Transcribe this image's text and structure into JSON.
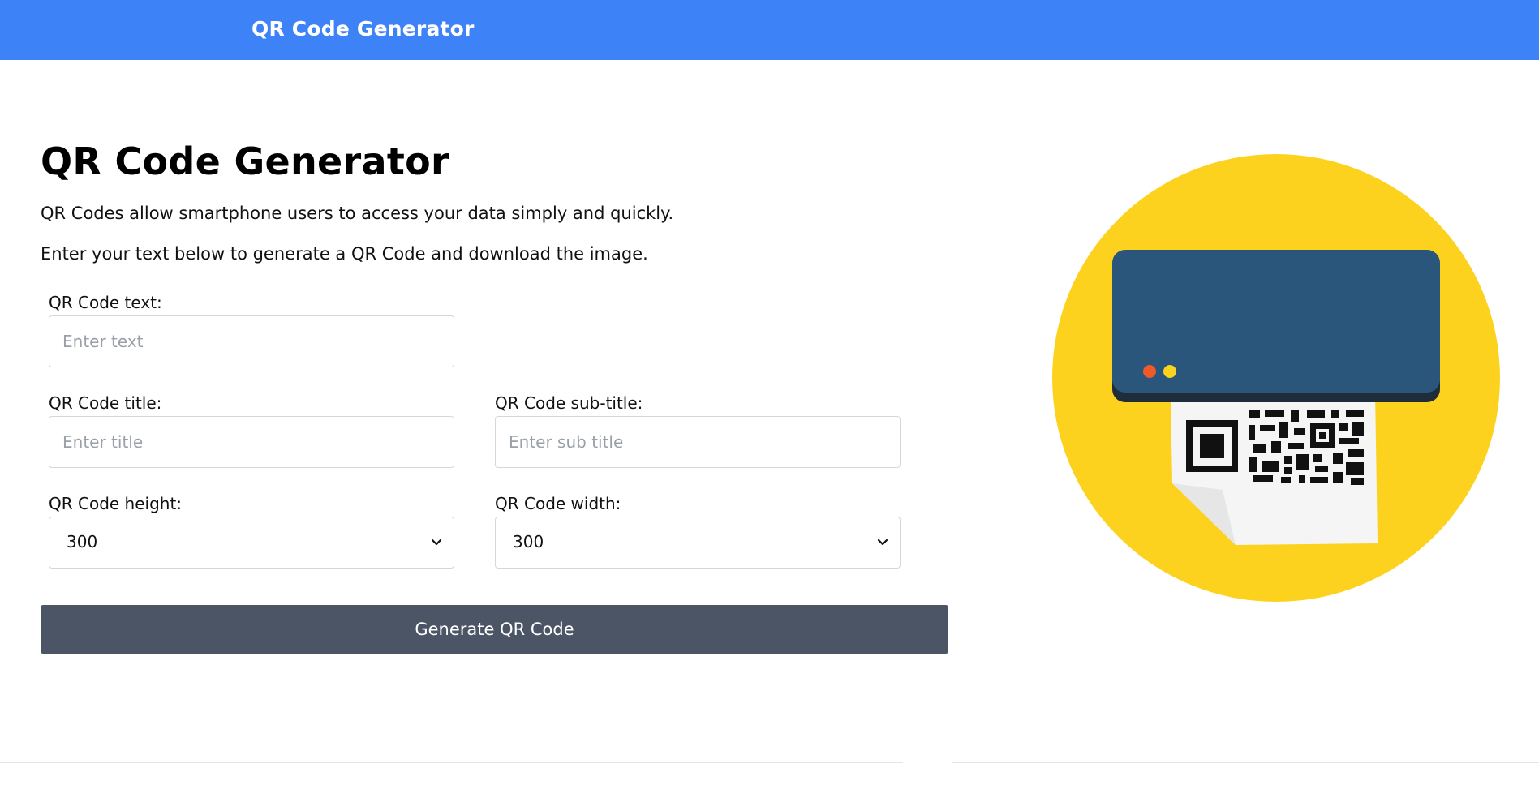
{
  "navbar": {
    "brand": "QR Code Generator"
  },
  "main": {
    "title": "QR Code Generator",
    "intro_1": "QR Codes allow smartphone users to access your data simply and quickly.",
    "intro_2": "Enter your text below to generate a QR Code and download the image."
  },
  "form": {
    "text": {
      "label": "QR Code text:",
      "placeholder": "Enter text",
      "value": ""
    },
    "title": {
      "label": "QR Code title:",
      "placeholder": "Enter title",
      "value": ""
    },
    "subtitle": {
      "label": "QR Code sub-title:",
      "placeholder": "Enter sub title",
      "value": ""
    },
    "height": {
      "label": "QR Code height:",
      "selected": "300"
    },
    "width": {
      "label": "QR Code width:",
      "selected": "300"
    },
    "generate_label": "Generate QR Code"
  },
  "colors": {
    "navbar": "#3d82f6",
    "button": "#4b5565",
    "illustration_circle": "#fdd21f",
    "printer_body": "#2b567c"
  },
  "icons": [
    "chevron-down-icon",
    "qr-printer-illustration"
  ]
}
